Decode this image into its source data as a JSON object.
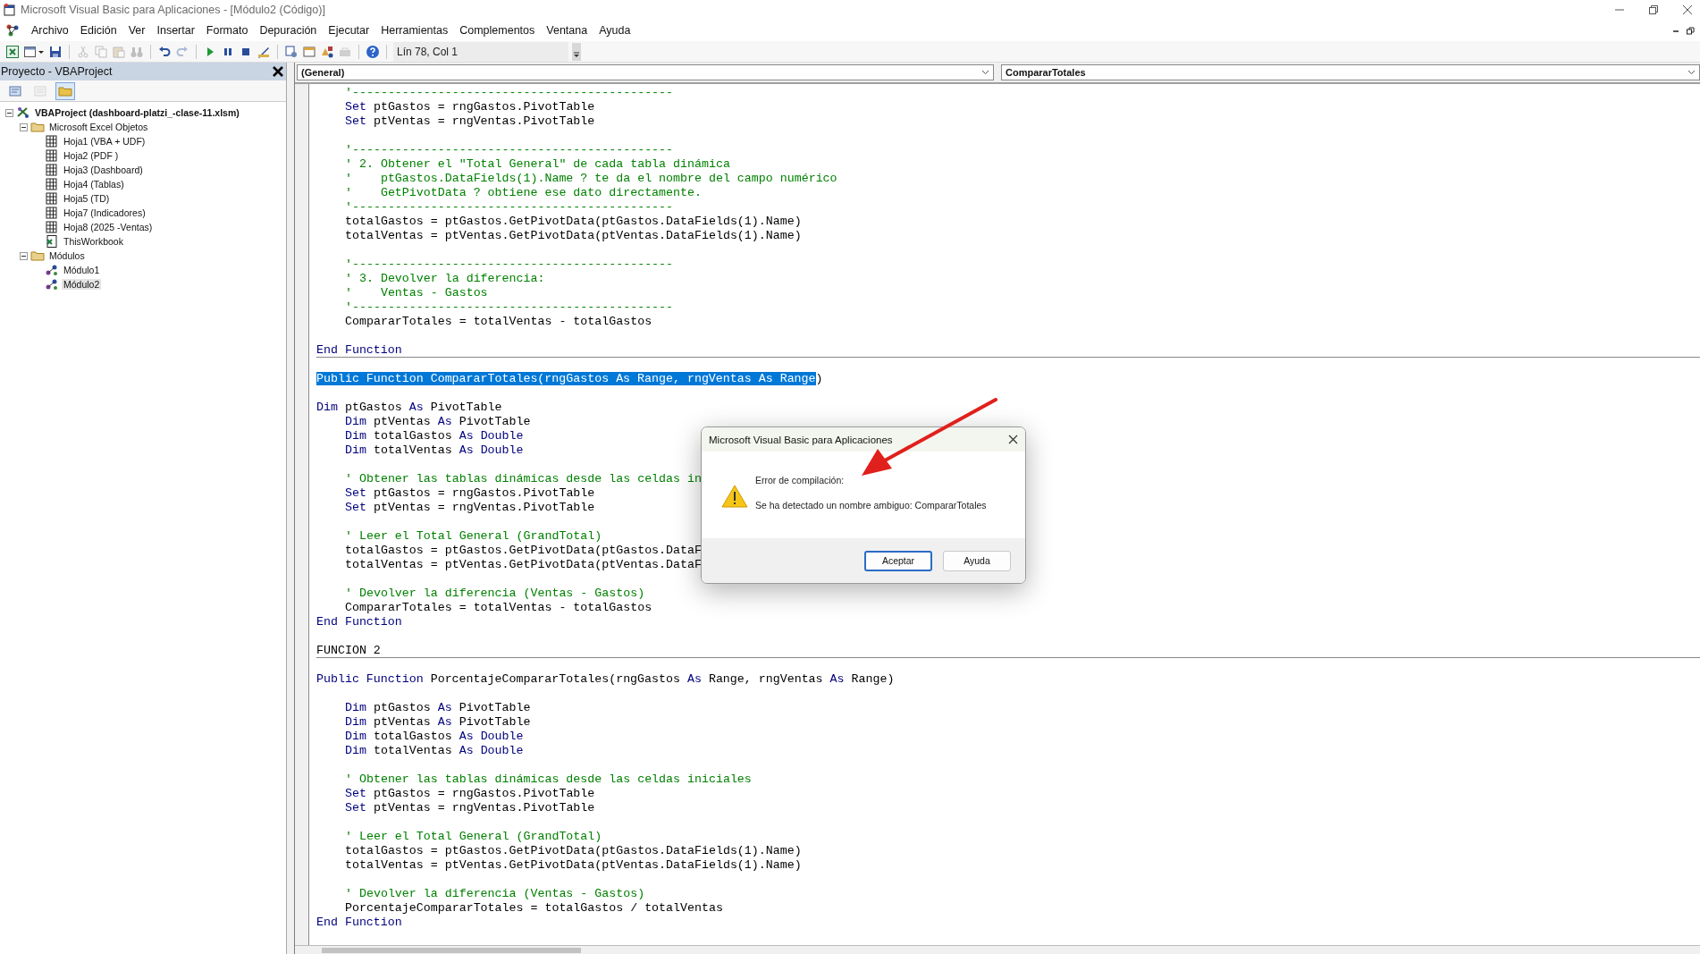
{
  "window": {
    "title": "Microsoft Visual Basic para Aplicaciones - [Módulo2 (Código)]"
  },
  "menu": [
    "Archivo",
    "Edición",
    "Ver",
    "Insertar",
    "Formato",
    "Depuración",
    "Ejecutar",
    "Herramientas",
    "Complementos",
    "Ventana",
    "Ayuda"
  ],
  "toolbar": {
    "groups": [
      [
        {
          "kind": "excel",
          "disabled": false
        },
        {
          "kind": "userform",
          "disabled": false
        },
        {
          "kind": "save",
          "disabled": false
        }
      ],
      [
        {
          "kind": "cut",
          "disabled": true
        },
        {
          "kind": "copy",
          "disabled": true
        },
        {
          "kind": "paste",
          "disabled": true
        },
        {
          "kind": "find",
          "disabled": true
        }
      ],
      [
        {
          "kind": "undo",
          "disabled": false
        },
        {
          "kind": "redo",
          "disabled": true
        }
      ],
      [
        {
          "kind": "run",
          "disabled": false
        },
        {
          "kind": "pause",
          "disabled": false
        },
        {
          "kind": "stop",
          "disabled": false
        },
        {
          "kind": "design",
          "disabled": false
        }
      ],
      [
        {
          "kind": "explorer",
          "disabled": false
        },
        {
          "kind": "properties",
          "disabled": false
        },
        {
          "kind": "browser",
          "disabled": false
        },
        {
          "kind": "toolbox",
          "disabled": true
        }
      ],
      [
        {
          "kind": "help",
          "disabled": false
        }
      ]
    ],
    "position": "Lín 78, Col 1"
  },
  "project": {
    "title": "Proyecto - VBAProject",
    "buttons": [
      {
        "kind": "view_code",
        "disabled": false,
        "pressed": false
      },
      {
        "kind": "view_object",
        "disabled": true,
        "pressed": false
      },
      {
        "kind": "toggle_folders",
        "disabled": false,
        "pressed": true
      }
    ],
    "tree": [
      {
        "label": "VBAProject (dashboard-platzi_-clase-11.xlsm)",
        "kind": "project",
        "expanded": true,
        "selected": false,
        "children": [
          {
            "label": "Microsoft Excel Objetos",
            "kind": "folder",
            "expanded": true,
            "selected": false,
            "children": [
              {
                "label": "Hoja1 (VBA + UDF)",
                "kind": "sheet",
                "selected": false
              },
              {
                "label": "Hoja2 (PDF )",
                "kind": "sheet",
                "selected": false
              },
              {
                "label": "Hoja3 (Dashboard)",
                "kind": "sheet",
                "selected": false
              },
              {
                "label": "Hoja4 (Tablas)",
                "kind": "sheet",
                "selected": false
              },
              {
                "label": "Hoja5 (TD)",
                "kind": "sheet",
                "selected": false
              },
              {
                "label": "Hoja7 (Indicadores)",
                "kind": "sheet",
                "selected": false
              },
              {
                "label": "Hoja8 (2025 -Ventas)",
                "kind": "sheet",
                "selected": false
              },
              {
                "label": "ThisWorkbook",
                "kind": "workbook",
                "selected": false
              }
            ]
          },
          {
            "label": "Módulos",
            "kind": "folder",
            "expanded": true,
            "selected": false,
            "children": [
              {
                "label": "Módulo1",
                "kind": "module",
                "selected": false
              },
              {
                "label": "Módulo2",
                "kind": "module",
                "selected": true
              }
            ]
          }
        ]
      }
    ]
  },
  "editor": {
    "object": "(General)",
    "procedure": "CompararTotales",
    "lines": [
      {
        "kind": "code",
        "indented": true,
        "tokens": [
          {
            "kind": "comment",
            "text": "'---------------------------------------------"
          }
        ]
      },
      {
        "kind": "code",
        "indented": true,
        "tokens": [
          {
            "kind": "keyword",
            "text": "Set"
          },
          {
            "kind": "plain",
            "text": " ptGastos = rngGastos.PivotTable"
          }
        ]
      },
      {
        "kind": "code",
        "indented": true,
        "tokens": [
          {
            "kind": "keyword",
            "text": "Set"
          },
          {
            "kind": "plain",
            "text": " ptVentas = rngVentas.PivotTable"
          }
        ]
      },
      {
        "kind": "blank"
      },
      {
        "kind": "code",
        "indented": true,
        "tokens": [
          {
            "kind": "comment",
            "text": "'---------------------------------------------"
          }
        ]
      },
      {
        "kind": "code",
        "indented": true,
        "tokens": [
          {
            "kind": "comment",
            "text": "' 2. Obtener el \"Total General\" de cada tabla dinámica"
          }
        ]
      },
      {
        "kind": "code",
        "indented": true,
        "tokens": [
          {
            "kind": "comment",
            "text": "'    ptGastos.DataFields(1).Name ? te da el nombre del campo numérico"
          }
        ]
      },
      {
        "kind": "code",
        "indented": true,
        "tokens": [
          {
            "kind": "comment",
            "text": "'    GetPivotData ? obtiene ese dato directamente."
          }
        ]
      },
      {
        "kind": "code",
        "indented": true,
        "tokens": [
          {
            "kind": "comment",
            "text": "'---------------------------------------------"
          }
        ]
      },
      {
        "kind": "code",
        "indented": true,
        "tokens": [
          {
            "kind": "plain",
            "text": "totalGastos = ptGastos.GetPivotData(ptGastos.DataFields(1).Name)"
          }
        ]
      },
      {
        "kind": "code",
        "indented": true,
        "tokens": [
          {
            "kind": "plain",
            "text": "totalVentas = ptVentas.GetPivotData(ptVentas.DataFields(1).Name)"
          }
        ]
      },
      {
        "kind": "blank"
      },
      {
        "kind": "code",
        "indented": true,
        "tokens": [
          {
            "kind": "comment",
            "text": "'---------------------------------------------"
          }
        ]
      },
      {
        "kind": "code",
        "indented": true,
        "tokens": [
          {
            "kind": "comment",
            "text": "' 3. Devolver la diferencia:"
          }
        ]
      },
      {
        "kind": "code",
        "indented": true,
        "tokens": [
          {
            "kind": "comment",
            "text": "'    Ventas - Gastos"
          }
        ]
      },
      {
        "kind": "code",
        "indented": true,
        "tokens": [
          {
            "kind": "comment",
            "text": "'---------------------------------------------"
          }
        ]
      },
      {
        "kind": "code",
        "indented": true,
        "tokens": [
          {
            "kind": "plain",
            "text": "CompararTotales = totalVentas - totalGastos"
          }
        ]
      },
      {
        "kind": "blank"
      },
      {
        "kind": "code",
        "indented": false,
        "divider_below": true,
        "tokens": [
          {
            "kind": "keyword",
            "text": "End Function"
          }
        ]
      },
      {
        "kind": "blank"
      },
      {
        "kind": "code",
        "indented": false,
        "tokens": [
          {
            "kind": "selection",
            "text": "Public Function CompararTotales(rngGastos As Range, rngVentas As Range"
          },
          {
            "kind": "plain",
            "text": ")"
          }
        ]
      },
      {
        "kind": "blank"
      },
      {
        "kind": "code",
        "indented": false,
        "tokens": [
          {
            "kind": "keyword",
            "text": "Dim"
          },
          {
            "kind": "plain",
            "text": " ptGastos "
          },
          {
            "kind": "keyword",
            "text": "As"
          },
          {
            "kind": "plain",
            "text": " PivotTable"
          }
        ]
      },
      {
        "kind": "code",
        "indented": true,
        "tokens": [
          {
            "kind": "keyword",
            "text": "Dim"
          },
          {
            "kind": "plain",
            "text": " ptVentas "
          },
          {
            "kind": "keyword",
            "text": "As"
          },
          {
            "kind": "plain",
            "text": " PivotTable"
          }
        ]
      },
      {
        "kind": "code",
        "indented": true,
        "tokens": [
          {
            "kind": "keyword",
            "text": "Dim"
          },
          {
            "kind": "plain",
            "text": " totalGastos "
          },
          {
            "kind": "keyword",
            "text": "As Double"
          }
        ]
      },
      {
        "kind": "code",
        "indented": true,
        "tokens": [
          {
            "kind": "keyword",
            "text": "Dim"
          },
          {
            "kind": "plain",
            "text": " totalVentas "
          },
          {
            "kind": "keyword",
            "text": "As Double"
          }
        ]
      },
      {
        "kind": "blank"
      },
      {
        "kind": "code",
        "indented": true,
        "tokens": [
          {
            "kind": "comment",
            "text": "' Obtener las tablas dinámicas desde las celdas in"
          }
        ]
      },
      {
        "kind": "code",
        "indented": true,
        "tokens": [
          {
            "kind": "keyword",
            "text": "Set"
          },
          {
            "kind": "plain",
            "text": " ptGastos = rngGastos.PivotTable"
          }
        ]
      },
      {
        "kind": "code",
        "indented": true,
        "tokens": [
          {
            "kind": "keyword",
            "text": "Set"
          },
          {
            "kind": "plain",
            "text": " ptVentas = rngVentas.PivotTable"
          }
        ]
      },
      {
        "kind": "blank"
      },
      {
        "kind": "code",
        "indented": true,
        "tokens": [
          {
            "kind": "comment",
            "text": "' Leer el Total General (GrandTotal)"
          }
        ]
      },
      {
        "kind": "code",
        "indented": true,
        "tokens": [
          {
            "kind": "plain",
            "text": "totalGastos = ptGastos.GetPivotData(ptGastos.DataF"
          }
        ]
      },
      {
        "kind": "code",
        "indented": true,
        "tokens": [
          {
            "kind": "plain",
            "text": "totalVentas = ptVentas.GetPivotData(ptVentas.DataF"
          }
        ]
      },
      {
        "kind": "blank"
      },
      {
        "kind": "code",
        "indented": true,
        "tokens": [
          {
            "kind": "comment",
            "text": "' Devolver la diferencia (Ventas - Gastos)"
          }
        ]
      },
      {
        "kind": "code",
        "indented": true,
        "tokens": [
          {
            "kind": "plain",
            "text": "CompararTotales = totalVentas - totalGastos"
          }
        ]
      },
      {
        "kind": "code",
        "indented": false,
        "tokens": [
          {
            "kind": "keyword",
            "text": "End Function"
          }
        ]
      },
      {
        "kind": "blank"
      },
      {
        "kind": "code",
        "indented": false,
        "divider_below": true,
        "tokens": [
          {
            "kind": "plain",
            "text": "FUNCION 2"
          }
        ]
      },
      {
        "kind": "blank"
      },
      {
        "kind": "code",
        "indented": false,
        "tokens": [
          {
            "kind": "keyword",
            "text": "Public Function"
          },
          {
            "kind": "plain",
            "text": " PorcentajeCompararTotales(rngGastos "
          },
          {
            "kind": "keyword",
            "text": "As"
          },
          {
            "kind": "plain",
            "text": " Range, rngVentas "
          },
          {
            "kind": "keyword",
            "text": "As"
          },
          {
            "kind": "plain",
            "text": " Range)"
          }
        ]
      },
      {
        "kind": "blank"
      },
      {
        "kind": "code",
        "indented": true,
        "tokens": [
          {
            "kind": "keyword",
            "text": "Dim"
          },
          {
            "kind": "plain",
            "text": " ptGastos "
          },
          {
            "kind": "keyword",
            "text": "As"
          },
          {
            "kind": "plain",
            "text": " PivotTable"
          }
        ]
      },
      {
        "kind": "code",
        "indented": true,
        "tokens": [
          {
            "kind": "keyword",
            "text": "Dim"
          },
          {
            "kind": "plain",
            "text": " ptVentas "
          },
          {
            "kind": "keyword",
            "text": "As"
          },
          {
            "kind": "plain",
            "text": " PivotTable"
          }
        ]
      },
      {
        "kind": "code",
        "indented": true,
        "tokens": [
          {
            "kind": "keyword",
            "text": "Dim"
          },
          {
            "kind": "plain",
            "text": " totalGastos "
          },
          {
            "kind": "keyword",
            "text": "As Double"
          }
        ]
      },
      {
        "kind": "code",
        "indented": true,
        "tokens": [
          {
            "kind": "keyword",
            "text": "Dim"
          },
          {
            "kind": "plain",
            "text": " totalVentas "
          },
          {
            "kind": "keyword",
            "text": "As Double"
          }
        ]
      },
      {
        "kind": "blank"
      },
      {
        "kind": "code",
        "indented": true,
        "tokens": [
          {
            "kind": "comment",
            "text": "' Obtener las tablas dinámicas desde las celdas iniciales"
          }
        ]
      },
      {
        "kind": "code",
        "indented": true,
        "tokens": [
          {
            "kind": "keyword",
            "text": "Set"
          },
          {
            "kind": "plain",
            "text": " ptGastos = rngGastos.PivotTable"
          }
        ]
      },
      {
        "kind": "code",
        "indented": true,
        "tokens": [
          {
            "kind": "keyword",
            "text": "Set"
          },
          {
            "kind": "plain",
            "text": " ptVentas = rngVentas.PivotTable"
          }
        ]
      },
      {
        "kind": "blank"
      },
      {
        "kind": "code",
        "indented": true,
        "tokens": [
          {
            "kind": "comment",
            "text": "' Leer el Total General (GrandTotal)"
          }
        ]
      },
      {
        "kind": "code",
        "indented": true,
        "tokens": [
          {
            "kind": "plain",
            "text": "totalGastos = ptGastos.GetPivotData(ptGastos.DataFields(1).Name)"
          }
        ]
      },
      {
        "kind": "code",
        "indented": true,
        "tokens": [
          {
            "kind": "plain",
            "text": "totalVentas = ptVentas.GetPivotData(ptVentas.DataFields(1).Name)"
          }
        ]
      },
      {
        "kind": "blank"
      },
      {
        "kind": "code",
        "indented": true,
        "tokens": [
          {
            "kind": "comment",
            "text": "' Devolver la diferencia (Ventas - Gastos)"
          }
        ]
      },
      {
        "kind": "code",
        "indented": true,
        "tokens": [
          {
            "kind": "plain",
            "text": "PorcentajeCompararTotales = totalGastos / totalVentas"
          }
        ]
      },
      {
        "kind": "code",
        "indented": false,
        "tokens": [
          {
            "kind": "keyword",
            "text": "End Function"
          }
        ]
      }
    ]
  },
  "dialog": {
    "title": "Microsoft Visual Basic para Aplicaciones",
    "heading": "Error de compilación:",
    "message": "Se ha detectado un nombre ambiguo: CompararTotales",
    "buttons": [
      {
        "label": "Aceptar",
        "default": true
      },
      {
        "label": "Ayuda",
        "default": false
      }
    ]
  }
}
